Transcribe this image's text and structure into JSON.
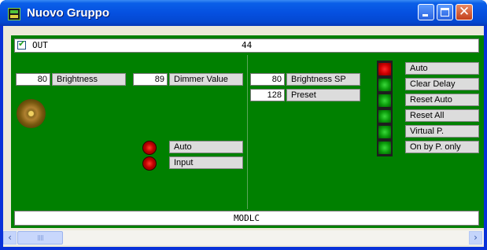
{
  "window": {
    "title": "Nuovo Gruppo"
  },
  "out": {
    "checked": true,
    "label": "OUT",
    "value": "44"
  },
  "left_panel": {
    "brightness": {
      "value": "80",
      "label": "Brightness"
    },
    "dimmer": {
      "value": "89",
      "label": "Dimmer Value"
    },
    "leds": [
      {
        "label": "Auto",
        "color": "#d00000"
      },
      {
        "label": "Input",
        "color": "#d00000"
      }
    ]
  },
  "right_panel": {
    "brightness_sp": {
      "value": "80",
      "label": "Brightness SP"
    },
    "preset": {
      "value": "128",
      "label": "Preset"
    },
    "status": [
      {
        "label": "Auto",
        "state": "red"
      },
      {
        "label": "Clear Delay",
        "state": "green"
      },
      {
        "label": "Reset Auto",
        "state": "green"
      },
      {
        "label": "Reset All",
        "state": "green"
      },
      {
        "label": "Virtual P.",
        "state": "green"
      },
      {
        "label": "On by P. only",
        "state": "green"
      }
    ]
  },
  "footer": {
    "label": "MODLC"
  },
  "scrollbar": {
    "left_arrow": "‹",
    "right_arrow": "›"
  },
  "colors": {
    "panel": "#008000",
    "titlebar": "#0550e0"
  }
}
